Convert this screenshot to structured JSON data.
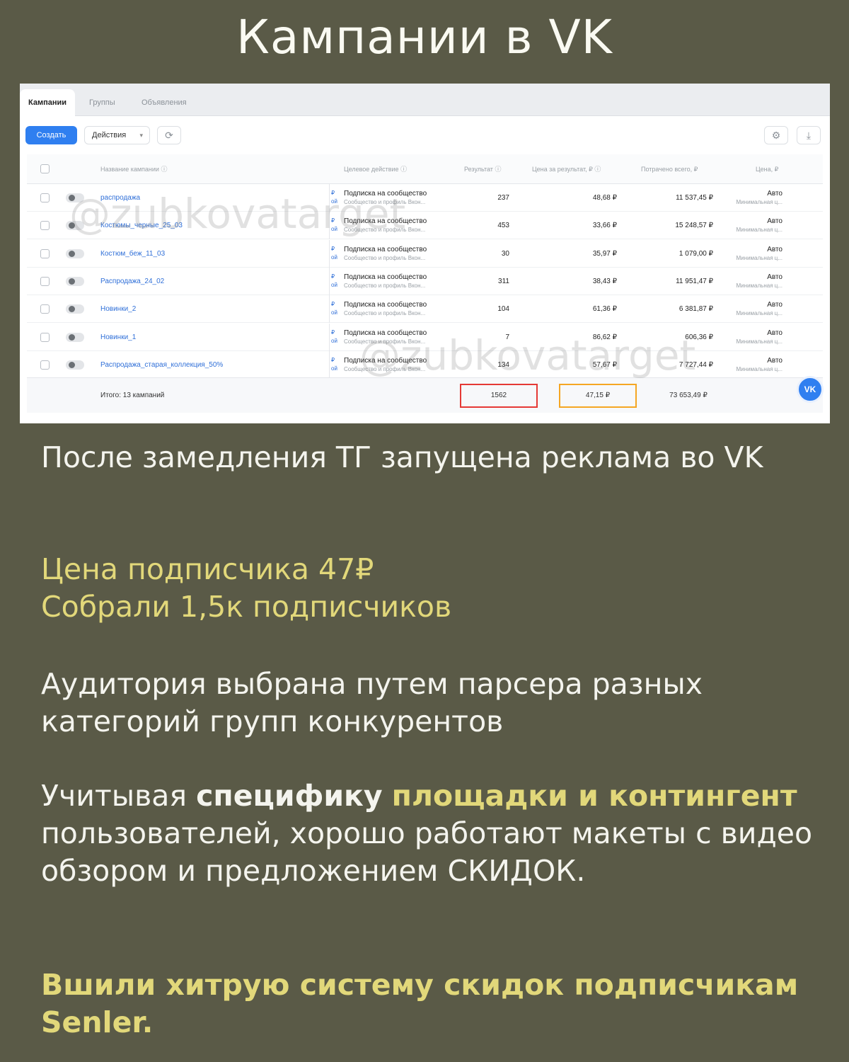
{
  "page_title": "Кампании в VK",
  "tabs": [
    "Кампании",
    "Группы",
    "Объявления"
  ],
  "toolbar": {
    "create_label": "Создать",
    "actions_label": "Действия"
  },
  "table": {
    "headers": {
      "name": "Название кампании",
      "goal": "Целевое действие",
      "result": "Результат",
      "cpr": "Цена за результат, ₽",
      "spent": "Потрачено всего, ₽",
      "price": "Цена, ₽"
    },
    "rows": [
      {
        "name": "распродажа",
        "goal": "Подписка на сообщество",
        "goal_sub": "Сообщество и профиль Вкон...",
        "result": "237",
        "cpr": "48,68 ₽",
        "spent": "11 537,45 ₽",
        "price": "Авто",
        "price_sub": "Минимальная ц..."
      },
      {
        "name": "Костюмы_черные_25_03",
        "goal": "Подписка на сообщество",
        "goal_sub": "Сообщество и профиль Вкон...",
        "result": "453",
        "cpr": "33,66 ₽",
        "spent": "15 248,57 ₽",
        "price": "Авто",
        "price_sub": "Минимальная ц..."
      },
      {
        "name": "Костюм_беж_11_03",
        "goal": "Подписка на сообщество",
        "goal_sub": "Сообщество и профиль Вкон...",
        "result": "30",
        "cpr": "35,97 ₽",
        "spent": "1 079,00 ₽",
        "price": "Авто",
        "price_sub": "Минимальная ц..."
      },
      {
        "name": "Распродажа_24_02",
        "goal": "Подписка на сообщество",
        "goal_sub": "Сообщество и профиль Вкон...",
        "result": "311",
        "cpr": "38,43 ₽",
        "spent": "11 951,47 ₽",
        "price": "Авто",
        "price_sub": "Минимальная ц..."
      },
      {
        "name": "Новинки_2",
        "goal": "Подписка на сообщество",
        "goal_sub": "Сообщество и профиль Вкон...",
        "result": "104",
        "cpr": "61,36 ₽",
        "spent": "6 381,87 ₽",
        "price": "Авто",
        "price_sub": "Минимальная ц..."
      },
      {
        "name": "Новинки_1",
        "goal": "Подписка на сообщество",
        "goal_sub": "Сообщество и профиль Вкон...",
        "result": "7",
        "cpr": "86,62 ₽",
        "spent": "606,36 ₽",
        "price": "Авто",
        "price_sub": "Минимальная ц..."
      },
      {
        "name": "Распродажа_старая_коллекция_50%",
        "goal": "Подписка на сообщество",
        "goal_sub": "Сообщество и профиль Вкон...",
        "result": "134",
        "cpr": "57,67 ₽",
        "spent": "7 727,44 ₽",
        "price": "Авто",
        "price_sub": "Минимальная ц..."
      }
    ],
    "totals": {
      "label": "Итого: 13 кампаний",
      "result": "1562",
      "cpr": "47,15 ₽",
      "spent": "73 653,49 ₽"
    }
  },
  "watermark": "@zubkovatarget",
  "vk_badge": "VK",
  "text": {
    "p1": "После замедления ТГ запущена реклама во VK",
    "p2_line1": "Цена подписчика 47₽",
    "p2_line2": "Собрали 1,5к подписчиков",
    "p3": "Аудитория выбрана путем парсера разных категорий групп конкурентов",
    "p4_a": "Учитывая ",
    "p4_b": "специфику",
    "p4_c": " ",
    "p4_d": "площадки и контингент",
    "p4_e": " пользователей, хорошо работают макеты с видео обзором и предложением СКИДОК.",
    "p5": "Вшили хитрую систему скидок подписчикам Senler."
  },
  "colors": {
    "background": "#5a5a47",
    "accent_yellow": "#e2d87a",
    "vk_blue": "#2f7ff0",
    "highlight_red": "#e53935",
    "highlight_orange": "#f5a623"
  }
}
